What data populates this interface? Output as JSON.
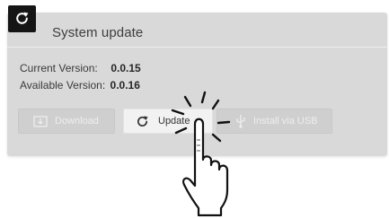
{
  "dialog": {
    "title": "System update",
    "app_icon": "refresh-icon"
  },
  "versions": {
    "current_label": "Current Version:",
    "current_value": "0.0.15",
    "available_label": "Available Version:",
    "available_value": "0.0.16"
  },
  "buttons": {
    "download_label": "Download",
    "download_icon": "download-icon",
    "update_label": "Update",
    "update_icon": "refresh-icon",
    "usb_label": "Install via USB",
    "usb_icon": "usb-icon"
  },
  "overlay": {
    "gesture": "tap-hand-icon"
  },
  "colors": {
    "card_background": "#d9d9d9",
    "badge_background": "#151515",
    "primary_button": "#f2f2f2",
    "disabled_button": "#cfcfcf"
  }
}
